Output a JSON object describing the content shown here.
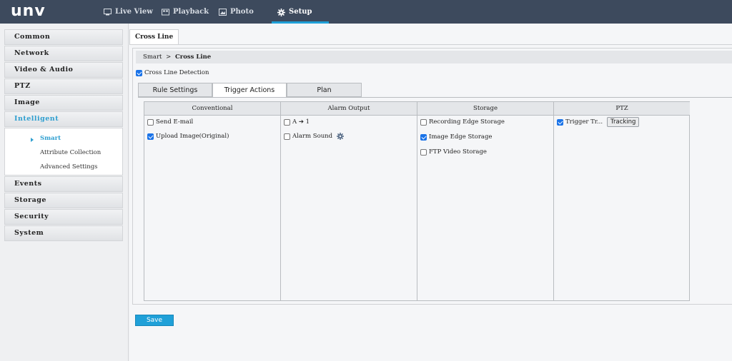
{
  "app": {
    "logo": "unv"
  },
  "nav": [
    {
      "label": "Live View",
      "icon": "monitor-icon"
    },
    {
      "label": "Playback",
      "icon": "film-icon"
    },
    {
      "label": "Photo",
      "icon": "photo-icon"
    },
    {
      "label": "Setup",
      "icon": "gear-icon"
    }
  ],
  "sidebar": {
    "items": [
      "Common",
      "Network",
      "Video & Audio",
      "PTZ",
      "Image",
      "Intelligent"
    ],
    "sub": [
      "Smart",
      "Attribute Collection",
      "Advanced Settings"
    ],
    "items_after": [
      "Events",
      "Storage",
      "Security",
      "System"
    ]
  },
  "content": {
    "tab": "Cross Line",
    "breadcrumb": {
      "parent": "Smart",
      "sep": ">",
      "current": "Cross Line"
    },
    "detection_label": "Cross Line Detection",
    "tabs": [
      "Rule Settings",
      "Trigger Actions",
      "Plan"
    ],
    "columns": {
      "conventional": {
        "header": "Conventional",
        "rows": [
          "Send E-mail",
          "Upload Image(Original)"
        ]
      },
      "alarm": {
        "header": "Alarm Output",
        "rows": [
          "A ➔ 1",
          "Alarm Sound"
        ]
      },
      "storage": {
        "header": "Storage",
        "rows": [
          "Recording Edge Storage",
          "Image Edge Storage",
          "FTP Video Storage"
        ]
      },
      "ptz": {
        "header": "PTZ",
        "trigger": "Trigger Tr...",
        "button": "Tracking"
      }
    },
    "save_label": "Save"
  },
  "colors": {
    "topbar": "#3d4a5d",
    "accent": "#1fa0d8",
    "active_text": "#2f9fd0"
  }
}
